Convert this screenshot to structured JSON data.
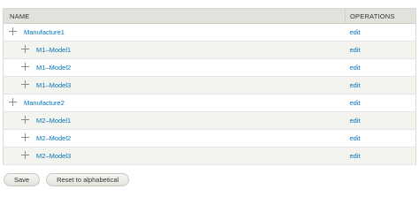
{
  "table": {
    "header_name": "NAME",
    "header_operations": "OPERATIONS",
    "rows": [
      {
        "name": "Manufacture1",
        "op": "edit",
        "child": false
      },
      {
        "name": "M1–Model1",
        "op": "edit",
        "child": true
      },
      {
        "name": "M1–Model2",
        "op": "edit",
        "child": true
      },
      {
        "name": "M1–Model3",
        "op": "edit",
        "child": true
      },
      {
        "name": "Manufacture2",
        "op": "edit",
        "child": false
      },
      {
        "name": "M2–Model1",
        "op": "edit",
        "child": true
      },
      {
        "name": "M2–Model2",
        "op": "edit",
        "child": true
      },
      {
        "name": "M2–Model3",
        "op": "edit",
        "child": true
      }
    ]
  },
  "actions": {
    "save_label": "Save",
    "reset_label": "Reset to alphabetical"
  }
}
